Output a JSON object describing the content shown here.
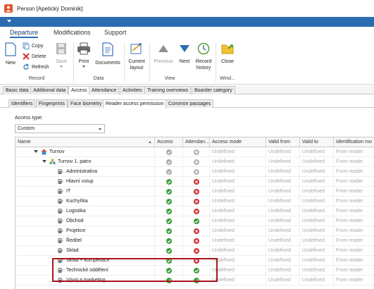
{
  "window": {
    "title": "Person [Apetický Dominik]"
  },
  "ribbon_tabs": [
    "Departure",
    "Modifications",
    "Support"
  ],
  "ribbon": {
    "record": {
      "new": "New",
      "copy": "Copy",
      "delete": "Delete",
      "refresh": "Refresh",
      "save": "Save",
      "label": "Record"
    },
    "data": {
      "print": "Print",
      "documents": "Documents",
      "current_layout": "Current layout",
      "label": "Data"
    },
    "view": {
      "previous": "Previous",
      "next": "Next",
      "record_history": "Record history",
      "label": "View"
    },
    "window": {
      "close": "Close",
      "label": "Wind..."
    }
  },
  "main_tabs": [
    "Basic data",
    "Additional data",
    "Access",
    "Attendance",
    "Activities",
    "Training overviews",
    "Boarder category"
  ],
  "sub_tabs": [
    "Identifiers",
    "Fingerprints",
    "Face biometry",
    "Reader access permission",
    "Common passages"
  ],
  "access_type": {
    "label": "Access type:",
    "value": "Custom"
  },
  "grid": {
    "columns": [
      "Name",
      "Access",
      "Attendan...",
      "Access mode",
      "Valid from",
      "Valid to",
      "Identification mo"
    ],
    "rows": [
      {
        "name": "Turnov",
        "access": "okdim",
        "attendance": "nodim",
        "mode": "Undefined",
        "from": "Undefined",
        "to": "Undefined",
        "ident": "From reader"
      },
      {
        "name": "Turnov 1. patro",
        "access": "okdim",
        "attendance": "nodim",
        "mode": "Undefined",
        "from": "Undefined",
        "to": "Undefined",
        "ident": "From reader"
      },
      {
        "name": "Administrativa",
        "access": "okdim",
        "attendance": "nodim",
        "mode": "Undefined",
        "from": "Undefined",
        "to": "Undefined",
        "ident": "From reader"
      },
      {
        "name": "Hlavní vstup",
        "access": "ok",
        "attendance": "no",
        "mode": "Undefined",
        "from": "Undefined",
        "to": "Undefined",
        "ident": "From reader"
      },
      {
        "name": "IT",
        "access": "ok",
        "attendance": "no",
        "mode": "Undefined",
        "from": "Undefined",
        "to": "Undefined",
        "ident": "From reader"
      },
      {
        "name": "Kuchyňka",
        "access": "ok",
        "attendance": "no",
        "mode": "Undefined",
        "from": "Undefined",
        "to": "Undefined",
        "ident": "From reader"
      },
      {
        "name": "Logistika",
        "access": "ok",
        "attendance": "no",
        "mode": "Undefined",
        "from": "Undefined",
        "to": "Undefined",
        "ident": "From reader"
      },
      {
        "name": "Obchod",
        "access": "ok",
        "attendance": "ok",
        "mode": "Undefined",
        "from": "Undefined",
        "to": "Undefined",
        "ident": "From reader"
      },
      {
        "name": "Projekce",
        "access": "ok",
        "attendance": "no",
        "mode": "Undefined",
        "from": "Undefined",
        "to": "Undefined",
        "ident": "From reader"
      },
      {
        "name": "Ředitel",
        "access": "ok",
        "attendance": "no",
        "mode": "Undefined",
        "from": "Undefined",
        "to": "Undefined",
        "ident": "From reader"
      },
      {
        "name": "Sklad",
        "access": "ok",
        "attendance": "no",
        "mode": "Undefined",
        "from": "Undefined",
        "to": "Undefined",
        "ident": "From reader"
      },
      {
        "name": "Sklad + kompletace",
        "access": "ok",
        "attendance": "no",
        "mode": "Undefined",
        "from": "Undefined",
        "to": "Undefined",
        "ident": "From reader"
      },
      {
        "name": "Technické oddělení",
        "access": "ok",
        "attendance": "ok",
        "mode": "Undefined",
        "from": "Undefined",
        "to": "Undefined",
        "ident": "From reader"
      },
      {
        "name": "Vývoj a marketing",
        "access": "ok",
        "attendance": "ok",
        "mode": "Undefined",
        "from": "Undefined",
        "to": "Undefined",
        "ident": "From reader"
      }
    ]
  },
  "colors": {
    "accent": "#2b6cb0",
    "ok": "#3a9c3a",
    "error": "#d33232",
    "highlight": "#a8141f"
  }
}
